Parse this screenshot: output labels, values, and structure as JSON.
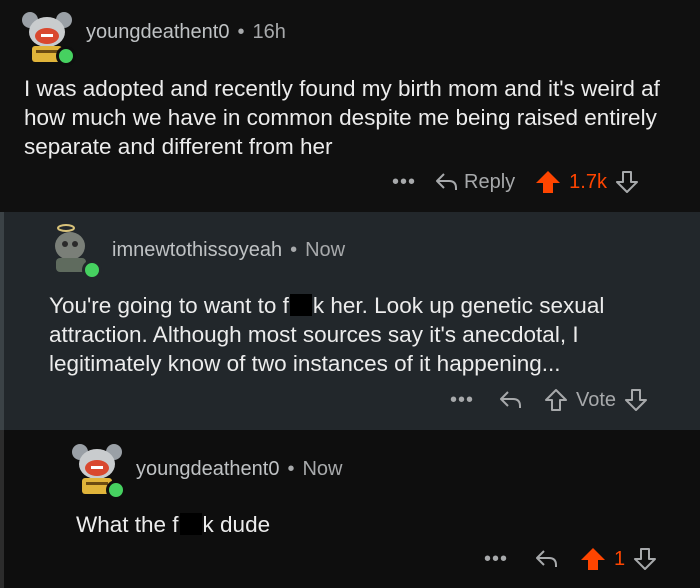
{
  "comments": [
    {
      "username": "youngdeathent0",
      "separator": "•",
      "time": "16h",
      "text": "I was adopted and recently found my birth mom and it's weird af how much we have in common despite me being raised entirely separate and different from her",
      "more": "•••",
      "reply_label": "Reply",
      "score": "1.7k",
      "upvoted": true
    },
    {
      "username": "imnewtothissoyeah",
      "separator": "•",
      "time": "Now",
      "text_before": "You're going to want to f",
      "text_after": "k her. Look up genetic sexual attraction. Although most sources say it's anecdotal, I legitimately know of two instances of it happening...",
      "more": "•••",
      "vote_label": "Vote",
      "upvoted": false
    },
    {
      "username": "youngdeathent0",
      "separator": "•",
      "time": "Now",
      "text_before": "What the f",
      "text_after": "k dude",
      "more": "•••",
      "score": "1",
      "upvoted": true
    }
  ],
  "colors": {
    "upvote": "#ff4500",
    "online": "#46d160",
    "background": "#0e0e0e",
    "reply_background": "#22272b"
  }
}
